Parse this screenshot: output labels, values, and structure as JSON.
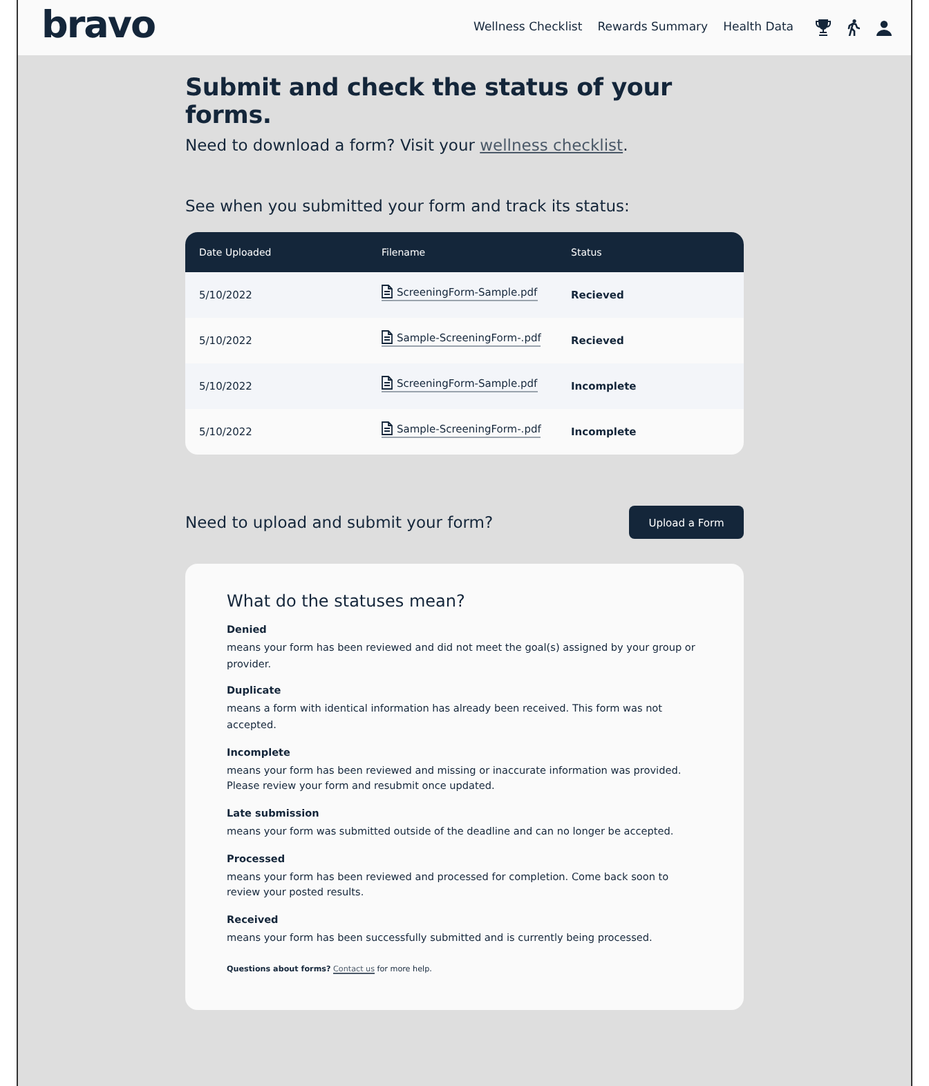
{
  "header": {
    "logo": "bravo",
    "nav": [
      "Wellness Checklist",
      "Rewards Summary",
      "Health Data"
    ]
  },
  "intro": {
    "title": "Submit and check the status of your forms.",
    "text_before": "Need to download a form? Visit your ",
    "link": "wellness checklist",
    "text_after": "."
  },
  "table": {
    "caption": "See when you submitted your form and track its status:",
    "columns": [
      "Date Uploaded",
      "Filename",
      "Status"
    ],
    "rows": [
      {
        "date": "5/10/2022",
        "filename": "ScreeningForm-Sample.pdf",
        "status": "Recieved"
      },
      {
        "date": "5/10/2022",
        "filename": "Sample-ScreeningForm-.pdf",
        "status": "Recieved"
      },
      {
        "date": "5/10/2022",
        "filename": "ScreeningForm-Sample.pdf",
        "status": "Incomplete"
      },
      {
        "date": "5/10/2022",
        "filename": "Sample-ScreeningForm-.pdf",
        "status": "Incomplete"
      }
    ]
  },
  "upload": {
    "prompt": "Need to upload and submit your form?",
    "button": "Upload a Form"
  },
  "statuses": {
    "title": "What do the statuses mean?",
    "items": [
      {
        "name": "Denied",
        "description": "means your form has been reviewed and did not meet the goal(s) assigned by your group or provider."
      },
      {
        "name": "Duplicate",
        "description": "means a form with identical information has already been received. This form was not accepted."
      },
      {
        "name": "Incomplete",
        "description": "means your form has been reviewed and missing or inaccurate information was provided. Please review your form and resubmit once updated."
      },
      {
        "name": "Late submission",
        "description": "means your form was submitted outside of the deadline and can no longer be accepted."
      },
      {
        "name": "Processed",
        "description": "means your form has been reviewed and processed for completion. Come back soon to review your posted results."
      },
      {
        "name": "Received",
        "description": "means your form has been successfully submitted and is currently being processed."
      }
    ],
    "help": {
      "text_before": "**Questions about forms?** ",
      "link": "Contact us",
      "text_after": " for more help."
    }
  }
}
